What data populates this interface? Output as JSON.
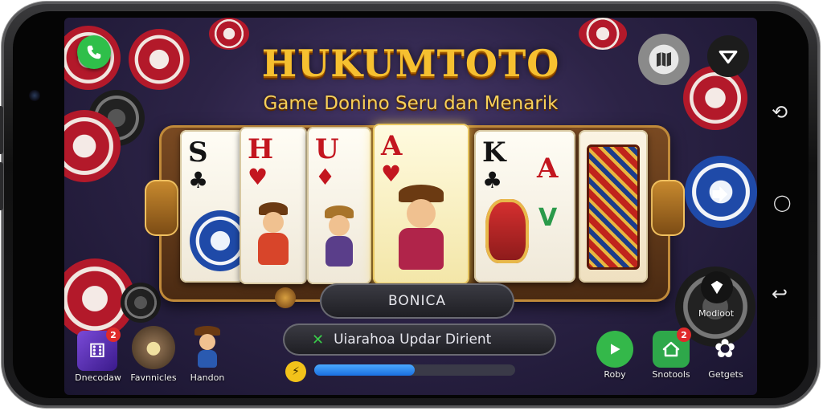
{
  "game": {
    "title": "HUKUMTOTO",
    "subtitle": "Game Donino Seru dan Menarik"
  },
  "cards": [
    {
      "rank": "S",
      "suit": "♣",
      "color": "black"
    },
    {
      "rank": "H",
      "suit": "♥",
      "color": "red"
    },
    {
      "rank": "U",
      "suit": "♦",
      "color": "red"
    },
    {
      "rank": "A",
      "suit": "♥",
      "color": "red"
    },
    {
      "rank": "K",
      "suit": "♣",
      "color": "black"
    },
    {
      "rank": "",
      "suit": "",
      "color": "red"
    }
  ],
  "bonus_button": {
    "label": "BONICA"
  },
  "update_banner": {
    "text": "Uiarahoa Updar Dirient",
    "icon": "x-cross-icon"
  },
  "progress": {
    "fraction": 0.5
  },
  "bottom_left": [
    {
      "label": "Dnecodaw",
      "icon": "dice-grid-icon",
      "badge": "2"
    },
    {
      "label": "Favnnicles",
      "icon": "domino-ball-icon",
      "badge": ""
    },
    {
      "label": "Handon",
      "icon": "cowboy-avatar-icon",
      "badge": ""
    }
  ],
  "bottom_right": [
    {
      "label": "Roby",
      "icon": "play-icon",
      "badge": ""
    },
    {
      "label": "Snotools",
      "icon": "home-icon",
      "badge": "2"
    },
    {
      "label": "Getgets",
      "icon": "gear-icon",
      "badge": ""
    }
  ],
  "right_side": {
    "notify_label": "Modioot"
  },
  "colors": {
    "accent_gold": "#f6c030",
    "progress_blue": "#2a86f0",
    "call_green": "#2fbf4a"
  }
}
